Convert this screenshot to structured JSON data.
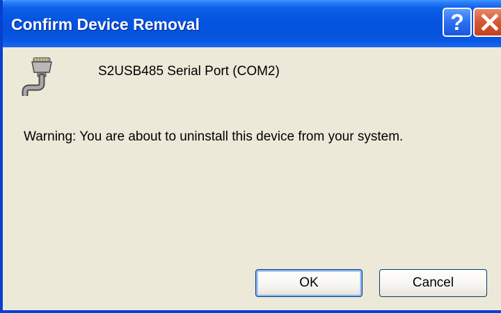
{
  "window": {
    "title": "Confirm Device Removal",
    "help_glyph": "?",
    "close_glyph": "×"
  },
  "device": {
    "icon": "serial-port-icon",
    "name": "S2USB485 Serial Port (COM2)"
  },
  "message": {
    "warning": "Warning: You are about to uninstall this device from your system."
  },
  "buttons": {
    "ok_label": "OK",
    "cancel_label": "Cancel"
  },
  "colors": {
    "titlebar": "#0553E0",
    "window_background": "#ECE9D8",
    "close_button": "#D65A34",
    "help_button": "#2B6FF0"
  }
}
